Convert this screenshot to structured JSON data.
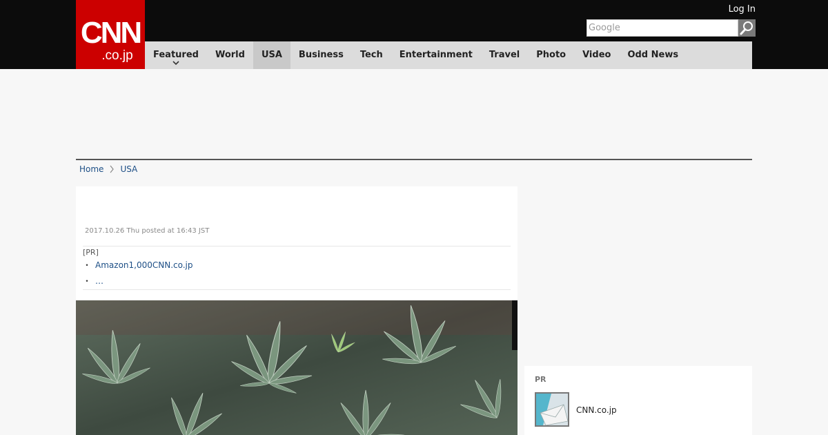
{
  "site": {
    "logo_main": "CNN",
    "logo_sub": ".co.jp",
    "login_label": "Log In",
    "search_placeholder": "Google",
    "brand_color": "#cc0000"
  },
  "nav": {
    "items": [
      {
        "label": "Featured",
        "has_dropdown": true
      },
      {
        "label": "World"
      },
      {
        "label": "USA",
        "active": true
      },
      {
        "label": "Business"
      },
      {
        "label": "Tech"
      },
      {
        "label": "Entertainment"
      },
      {
        "label": "Travel"
      },
      {
        "label": "Photo"
      },
      {
        "label": "Video"
      },
      {
        "label": "Odd News"
      }
    ]
  },
  "breadcrumb": {
    "home": "Home",
    "current": "USA"
  },
  "article": {
    "posted": "2017.10.26 Thu posted at 16:43 JST",
    "pr_label": "[PR]",
    "pr_links": [
      "Amazon1,000CNN.co.jp",
      "…"
    ]
  },
  "sidebar": {
    "pr_title": "PR",
    "pr_item": "CNN.co.jp"
  },
  "icons": {
    "search": "search-icon",
    "dropdown": "chevron-down-icon",
    "breadcrumb_separator": "chevron-right-icon",
    "thumbnail": "mail-icon"
  }
}
